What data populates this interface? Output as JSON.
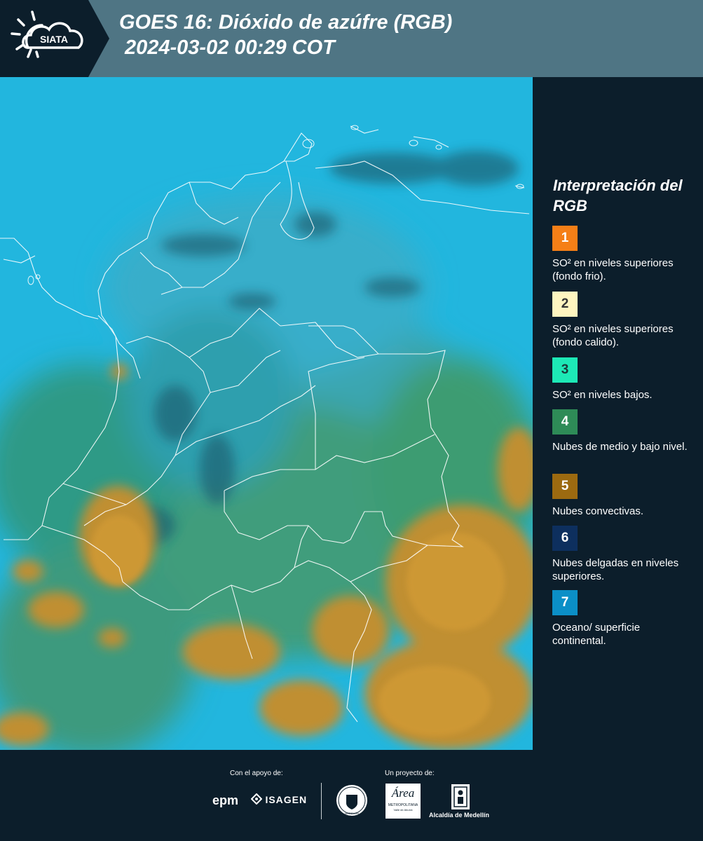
{
  "header": {
    "logo_text": "SIATA",
    "title_line1": "GOES 16: Dióxido de azúfre (RGB)",
    "title_line2": "2024-03-02 00:29 COT"
  },
  "legend": {
    "title": "Interpretación del RGB",
    "items": [
      {
        "num": "1",
        "color": "#f57f17",
        "text": "SO² en niveles superiores (fondo frio).",
        "num_color": "#ffffff"
      },
      {
        "num": "2",
        "color": "#fff5c0",
        "text": "SO² en niveles superiores (fondo calido).",
        "num_color": "#333333"
      },
      {
        "num": "3",
        "color": "#1de9b6",
        "text": "SO² en niveles bajos.",
        "num_color": "#1a3a3a"
      },
      {
        "num": "4",
        "color": "#2e8b57",
        "text": "Nubes de medio y bajo nivel.",
        "num_color": "#ffffff"
      },
      {
        "num": "5",
        "color": "#9c6a10",
        "text": "Nubes convectivas.",
        "num_color": "#ffffff"
      },
      {
        "num": "6",
        "color": "#0d2f5e",
        "text": "Nubes delgadas en niveles superiores.",
        "num_color": "#ffffff"
      },
      {
        "num": "7",
        "color": "#0b8fc7",
        "text": "Oceano/ superficie continental.",
        "num_color": "#ffffff"
      }
    ]
  },
  "footer": {
    "support_label": "Con el apoyo de:",
    "project_label": "Un proyecto de:",
    "epm": "epm",
    "isagen": "ISAGEN",
    "area_word": "Área",
    "area_sub": "METROPOLITANA",
    "area_sub2": "Valle de Aburrá",
    "alcaldia": "Alcaldía de Medellín",
    "medellin_seal": "MEDELLÍN"
  },
  "colors": {
    "header_bg": "#4f7584",
    "panel_bg": "#0c1e2b",
    "ocean": "#1fb8e0",
    "land_teal": "#2aa7b8",
    "land_green": "#3f9a6a",
    "convective": "#b98a2c"
  }
}
